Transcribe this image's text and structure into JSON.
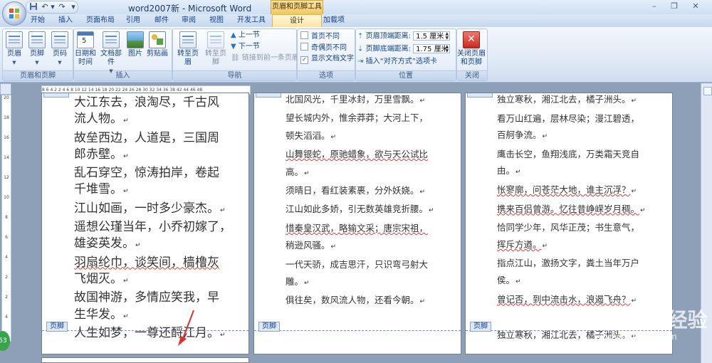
{
  "window": {
    "title": "word2007新 - Microsoft Word",
    "contextual_tools": "页眉和页脚工具",
    "controls": [
      "–",
      "❐",
      "✕"
    ]
  },
  "quick_access": {
    "icons": [
      "save-icon",
      "undo-icon",
      "redo-icon",
      "customize-icon"
    ],
    "undo": "↶",
    "redo": "↷",
    "more": "▾"
  },
  "tabs": [
    "开始",
    "插入",
    "页面布局",
    "引用",
    "邮件",
    "审阅",
    "视图",
    "开发工具",
    "加载项"
  ],
  "active_tab": "设计",
  "ribbon": {
    "header_footer": {
      "label": "页眉和页脚",
      "buttons": [
        "页眉",
        "页脚",
        "页码"
      ]
    },
    "insert": {
      "label": "插入",
      "buttons": [
        "日期和时间",
        "文档部件",
        "图片",
        "剪贴画"
      ]
    },
    "navigation": {
      "label": "导航",
      "goto_header": "转至页眉",
      "goto_footer": "转至页脚",
      "prev_section": "上一节",
      "next_section": "下一节",
      "link_previous": "链接到前一条页眉"
    },
    "options": {
      "label": "选项",
      "diff_first": "首页不同",
      "diff_odd_even": "奇偶页不同",
      "show_doc_text": "显示文档文字"
    },
    "position": {
      "label": "位置",
      "header_top_label": "页眉顶端距离:",
      "header_top_value": "1.5 厘米",
      "footer_bottom_label": "页脚底端距离:",
      "footer_bottom_value": "1.75 厘米",
      "insert_align_tab": "插入“对齐方式”选项卡"
    },
    "close": {
      "label": "关闭",
      "button": "关闭页眉和页脚"
    }
  },
  "ruler": {
    "horizontal_ticks": "8 6 4 2 2 4 6 8 10 12 14 16 18 20 22 24 26 28 30 32 34 36 38 42 44 46 48",
    "vertical_ticks": [
      "20",
      "18",
      "16",
      "14",
      "12",
      "10",
      "8",
      "6",
      "4",
      "2",
      "2",
      "4"
    ]
  },
  "pages": [
    {
      "lines": [
        "大江东去，浪淘尽，千古风",
        "流人物。",
        "故垒西边，人道是，三国周",
        "郎赤壁。",
        "乱石穿空，惊涛拍岸，卷起",
        "千堆雪。",
        "江山如画，一时多少豪杰。",
        "遥想公瑾当年，小乔初嫁了，",
        "雄姿英发。",
        "羽扇纶巾，谈笑间，樯橹灰",
        "飞烟灭。",
        "故国神游，多情应笑我，早",
        "生华发。",
        "人生如梦，一尊还酹江月。"
      ],
      "footer_label": "页脚"
    },
    {
      "lines": [
        "北国风光，千里冰封，万里雪飘。",
        "望长城内外，惟余莽莽；大河上下，",
        "顿失滔滔。",
        "山舞银蛇，原驰蜡象，欲与天公试比",
        "高。",
        "须晴日，看红装素裹，分外妖娆。",
        "江山如此多娇，引无数英雄竞折腰。",
        "惜秦皇汉武，略输文采；唐宗宋祖，",
        "稍逊风骚。",
        "一代天骄，成吉思汗，只识弯弓射大",
        "雕。",
        "俱往矣，数风流人物，还看今朝。"
      ],
      "footer_label": "页脚"
    },
    {
      "lines": [
        "独立寒秋，湘江北去，橘子洲头。",
        "看万山红遍，层林尽染；漫江碧透，",
        "百舸争流。",
        "鹰击长空，鱼翔浅底，万类霜天竞自",
        "由。",
        "怅寥廓，问苍茫大地，谁主沉浮？",
        "携来百侣曾游。忆往昔峥嵘岁月稠。",
        "恰同学少年，风华正茂；书生意气，",
        "挥斥方遒。",
        "指点江山，激扬文字，粪土当年万户",
        "侯。",
        "曾记否，到中流击水，浪遏飞舟？",
        "",
        "独立寒秋，湘江北去，橘子洲头。"
      ],
      "footer_label": "页脚"
    }
  ],
  "paragraph_mark": "↵",
  "watermark": {
    "text": "Baidu 经验",
    "url": "jingyan.baidu.com"
  },
  "badge": "53"
}
